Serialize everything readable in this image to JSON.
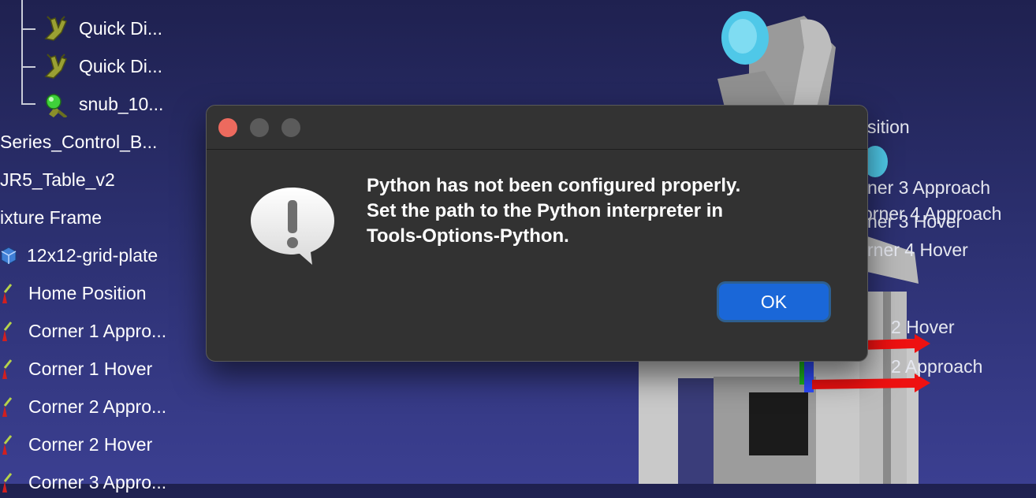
{
  "tree": {
    "items": [
      {
        "label": "Quick Di...",
        "icon": "gripper-icon"
      },
      {
        "label": "Quick Di...",
        "icon": "gripper-icon"
      },
      {
        "label": "snub_10...",
        "icon": "gripper-green-icon"
      },
      {
        "label": "Series_Control_B...",
        "icon": ""
      },
      {
        "label": "JR5_Table_v2",
        "icon": ""
      },
      {
        "label": "ixture Frame",
        "icon": ""
      },
      {
        "label": "12x12-grid-plate",
        "icon": "cube-icon"
      },
      {
        "label": "Home Position",
        "icon": "target-icon"
      },
      {
        "label": "Corner 1 Appro...",
        "icon": "target-icon"
      },
      {
        "label": "Corner 1 Hover",
        "icon": "target-icon"
      },
      {
        "label": "Corner 2 Appro...",
        "icon": "target-icon"
      },
      {
        "label": "Corner 2 Hover",
        "icon": "target-icon"
      },
      {
        "label": "Corner 3 Appro...",
        "icon": "target-icon"
      }
    ]
  },
  "scene": {
    "labels": [
      "sition",
      "ner 3 Approach",
      "orner 4 Approach",
      "ner 3 Hover",
      "rner 4 Hover",
      "2 Hover",
      "2 Approach"
    ]
  },
  "dialog": {
    "message_lines": [
      "Python has not been configured properly.",
      "Set the path to the Python interpreter in",
      "Tools-Options-Python."
    ],
    "ok_label": "OK",
    "icon": "alert-icon"
  },
  "colors": {
    "accent": "#1a67d8",
    "close_light": "#ed6a5e",
    "dialog_bg": "#323232"
  }
}
